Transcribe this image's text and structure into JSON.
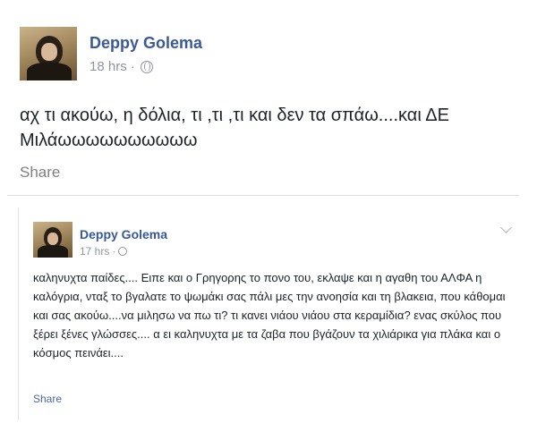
{
  "post1": {
    "author": "Deppy Golema",
    "time": "18 hrs",
    "separator": "·",
    "text": "αχ τι ακούω, η δόλια, τι ,τι ,τι και δεν τα σπάω....και ΔΕ Μιλάωωωωωωωωωω",
    "share_label": "Share"
  },
  "post2": {
    "author": "Deppy Golema",
    "time": "17 hrs",
    "separator": "·",
    "text": "καληνυχτα παίδες.... Ειπε και ο Γρηγορης το πονο του, εκλαψε και η αγαθη του ΑΛΦΑ η καλόγρια, νταξ το βγαλατε το ψωμάκι σας πάλι μες την ανοησία και τη βλακεια, που κάθομαι και σας ακούω....να μιλησω να πω τι? τι κανει νιάου νιάου στα κεραμίδια? ενας σκύλος που ξέρει ξένες γλώσσες.... α ει καληνυχτα με τα ζαβα που βγάζουν τα χιλιάρικα για πλάκα και ο κόσμος πεινάει....",
    "share_label": "Share"
  },
  "icons": {
    "audience": "globe-icon",
    "options": "chevron-down-icon"
  }
}
